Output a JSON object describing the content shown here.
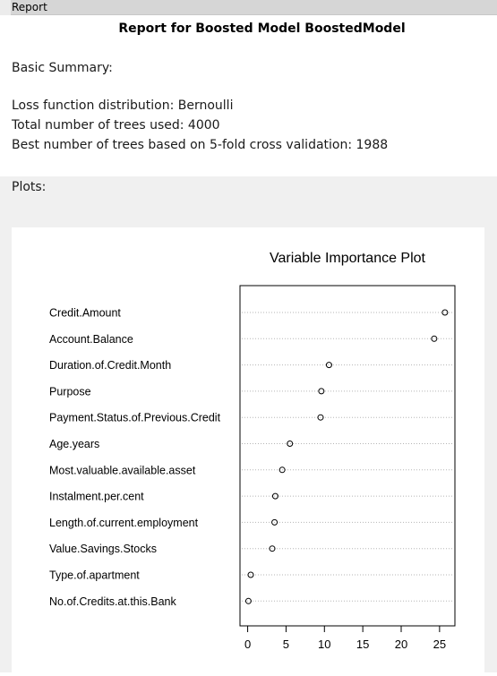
{
  "tab": {
    "label": "Report"
  },
  "report": {
    "title": "Report for Boosted Model BoostedModel",
    "basic_summary": "Basic Summary:",
    "loss_function": "Loss function distribution: Bernoulli",
    "total_trees": "Total number of trees used: 4000",
    "best_trees": "Best number of trees based on 5-fold cross validation: 1988",
    "plots_label": "Plots:"
  },
  "chart_data": {
    "type": "scatter",
    "title": "Variable Importance Plot",
    "xlabel": "",
    "ylabel": "",
    "categories": [
      "Credit.Amount",
      "Account.Balance",
      "Duration.of.Credit.Month",
      "Purpose",
      "Payment.Status.of.Previous.Credit",
      "Age.years",
      "Most.valuable.available.asset",
      "Instalment.per.cent",
      "Length.of.current.employment",
      "Value.Savings.Stocks",
      "Type.of.apartment",
      "No.of.Credits.at.this.Bank"
    ],
    "values": [
      25.7,
      24.3,
      10.6,
      9.6,
      9.5,
      5.5,
      4.5,
      3.6,
      3.5,
      3.2,
      0.4,
      0.1
    ],
    "xlim": [
      -1,
      27
    ],
    "xticks": [
      0,
      5,
      10,
      15,
      20,
      25
    ],
    "grid": "dotted horizontal lines per category",
    "marker": "open circle"
  }
}
